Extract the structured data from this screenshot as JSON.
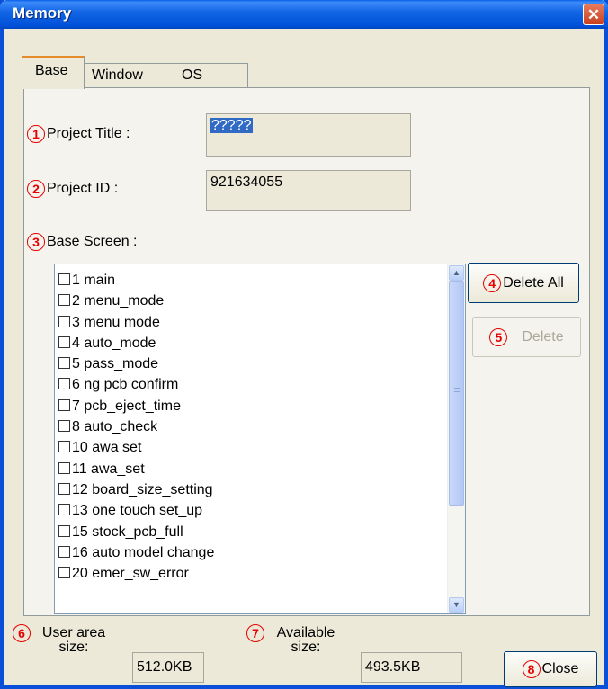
{
  "window": {
    "title": "Memory",
    "close_glyph": "✕"
  },
  "tabs": [
    {
      "label": "Base"
    },
    {
      "label": "Window"
    },
    {
      "label": "OS"
    }
  ],
  "markers": [
    "1",
    "2",
    "3",
    "4",
    "5",
    "6",
    "7",
    "8"
  ],
  "project_title": {
    "label": "Project Title :",
    "value": "?????"
  },
  "project_id": {
    "label": "Project ID :",
    "value": "921634055"
  },
  "base_screen": {
    "label": "Base Screen :",
    "items": [
      "1 main",
      "2 menu_mode",
      "3 menu mode",
      "4 auto_mode",
      "5 pass_mode",
      "6 ng pcb confirm",
      "7 pcb_eject_time",
      "8 auto_check",
      "10 awa set",
      "11 awa_set",
      "12 board_size_setting",
      "13 one touch set_up",
      "15 stock_pcb_full",
      "16 auto model change",
      "20 emer_sw_error"
    ]
  },
  "buttons": {
    "delete_all": "Delete All",
    "delete": "Delete",
    "close": "Close"
  },
  "user_area": {
    "label_line1": "User area",
    "label_line2": "size:",
    "value": "512.0KB"
  },
  "available": {
    "label_line1": "Available",
    "label_line2": "size:",
    "value": "493.5KB"
  },
  "icons": {
    "scroll_up": "▲",
    "scroll_down": "▼",
    "close": "close-icon"
  }
}
